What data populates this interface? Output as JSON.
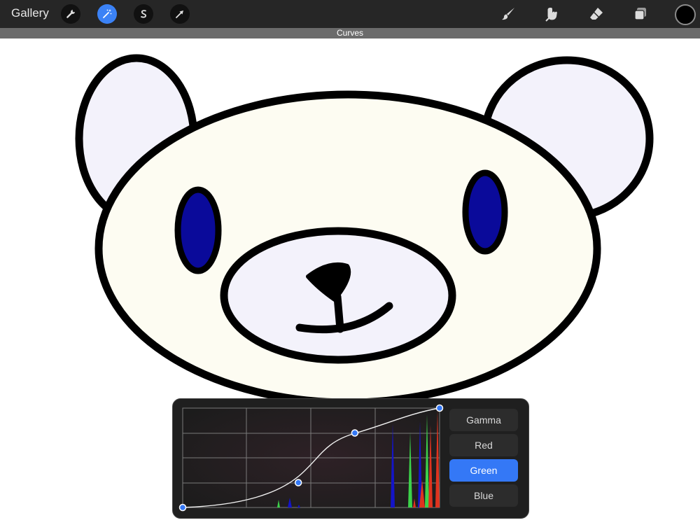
{
  "toolbar": {
    "gallery_label": "Gallery",
    "left_tools": [
      "wrench-icon",
      "magic-wand-icon",
      "selection-icon",
      "transform-arrow-icon"
    ],
    "active_tool": "magic-wand-icon",
    "right_tools": [
      "brush-icon",
      "smudge-icon",
      "eraser-icon",
      "layers-icon"
    ],
    "current_color": "#000000"
  },
  "mode_bar": {
    "label": "Curves"
  },
  "canvas": {
    "colors": {
      "outline": "#000000",
      "ear_fill": "#f3f2fb",
      "face_fill": "#fdfcf2",
      "eye_fill": "#0a0a9a",
      "muzzle_fill": "#f3f2fb"
    }
  },
  "curves": {
    "channels": [
      "Gamma",
      "Red",
      "Green",
      "Blue"
    ],
    "selected_channel": "Green",
    "curve_points": [
      [
        0,
        0
      ],
      [
        0.45,
        0.25
      ],
      [
        0.67,
        0.75
      ],
      [
        1,
        1
      ]
    ],
    "accent_color": "#3478f6"
  }
}
